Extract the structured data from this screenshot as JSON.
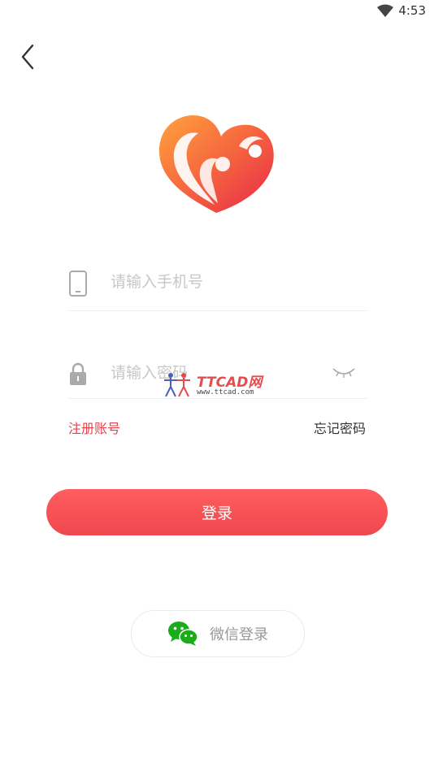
{
  "status_bar": {
    "time": "4:53"
  },
  "form": {
    "phone_placeholder": "请输入手机号",
    "password_placeholder": "请输入密码"
  },
  "links": {
    "register": "注册账号",
    "forgot": "忘记密码"
  },
  "login_button": "登录",
  "wechat_button": "微信登录",
  "watermark": {
    "title": "TTCAD网",
    "url": "www.ttcad.com"
  },
  "colors": {
    "accent": "#f0474f",
    "register_link": "#e8414a",
    "wechat_green": "#1aad19",
    "logo_gradient_start": "#ff9a3c",
    "logo_gradient_end": "#e8264a"
  },
  "icons": {
    "back": "chevron-left-icon",
    "phone": "phone-icon",
    "lock": "lock-icon",
    "eye": "eye-closed-icon",
    "wechat": "wechat-icon",
    "wifi": "wifi-icon"
  }
}
